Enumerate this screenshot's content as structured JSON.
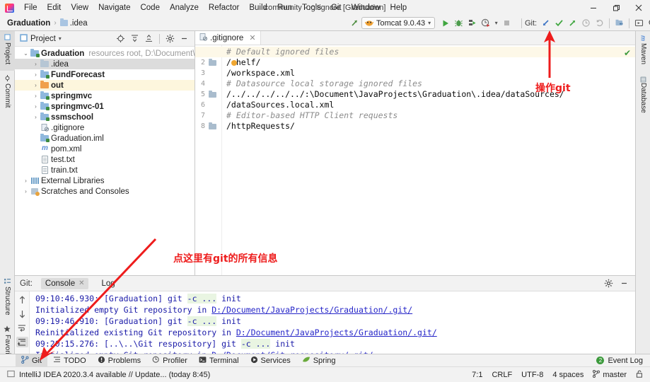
{
  "window": {
    "title": "community - .gitignore [Graduation]",
    "minimize": "—",
    "maximize": "❐",
    "close": "✕"
  },
  "menubar": {
    "logo_name": "intellij-idea-logo",
    "items": [
      "File",
      "Edit",
      "View",
      "Navigate",
      "Code",
      "Analyze",
      "Refactor",
      "Build",
      "Run",
      "Tools",
      "Git",
      "Window",
      "Help"
    ]
  },
  "navbar": {
    "breadcrumbs": [
      "Graduation",
      ".idea"
    ],
    "separator": "›",
    "back_icon": "↖",
    "run_config": {
      "label": "Tomcat 9.0.43",
      "chevron": "▾"
    },
    "run_button": "▶",
    "debug_button": "debug-bug-icon",
    "run_coverage_button": "run-with-coverage-icon",
    "profile_button": "profiler-icon",
    "profile_chevron": "▾",
    "stop_button": "■",
    "git_label": "Git:",
    "git_update": "↙",
    "git_commit": "✓",
    "git_push": "↗",
    "git_history": "◴",
    "git_rollback": "↺",
    "search_everywhere": "⌕",
    "project_structure": "project-structure-icon",
    "select_in": "select-opened-file-icon"
  },
  "left_strip": {
    "top": [
      {
        "label": "Project",
        "icon": "project-icon",
        "selected": true
      },
      {
        "label": "Commit",
        "icon": "commit-icon",
        "selected": false
      }
    ],
    "bottom": [
      {
        "label": "Structure",
        "icon": "structure-icon"
      },
      {
        "label": "Favorites",
        "icon": "star-icon"
      }
    ]
  },
  "right_strip": {
    "items": [
      {
        "label": "Maven",
        "icon": "maven-icon"
      },
      {
        "label": "Database",
        "icon": "database-icon"
      }
    ]
  },
  "project_panel": {
    "title": "Project",
    "title_chevron": "▾",
    "tools": {
      "locate": "crosshair-icon",
      "expand_all": "expand-all-icon",
      "collapse_all": "collapse-all-icon",
      "settings": "gear-icon",
      "hide": "—"
    },
    "tree": [
      {
        "depth": 0,
        "arrow": "⌄",
        "icon": "folder-module",
        "label": "Graduation",
        "bold": true,
        "sub": "resources root, D:\\Document\\JavaProj",
        "state": "none"
      },
      {
        "depth": 1,
        "arrow": "›",
        "icon": "folder-plain",
        "label": ".idea",
        "bold": false,
        "sub": "",
        "state": "selected-grey"
      },
      {
        "depth": 1,
        "arrow": "›",
        "icon": "folder-module",
        "label": "FundForecast",
        "bold": true,
        "sub": "",
        "state": "none"
      },
      {
        "depth": 1,
        "arrow": "›",
        "icon": "folder-excluded",
        "label": "out",
        "bold": true,
        "sub": "",
        "state": "selected-yellow"
      },
      {
        "depth": 1,
        "arrow": "›",
        "icon": "folder-module",
        "label": "springmvc",
        "bold": true,
        "sub": "",
        "state": "none"
      },
      {
        "depth": 1,
        "arrow": "›",
        "icon": "folder-module",
        "label": "springmvc-01",
        "bold": true,
        "sub": "",
        "state": "none"
      },
      {
        "depth": 1,
        "arrow": "›",
        "icon": "folder-module",
        "label": "ssmschool",
        "bold": true,
        "sub": "",
        "state": "none"
      },
      {
        "depth": 1,
        "arrow": "",
        "icon": "gitignore-file",
        "label": ".gitignore",
        "bold": false,
        "sub": "",
        "state": "none"
      },
      {
        "depth": 1,
        "arrow": "",
        "icon": "iml-file",
        "label": "Graduation.iml",
        "bold": false,
        "sub": "",
        "state": "none"
      },
      {
        "depth": 1,
        "arrow": "",
        "icon": "maven-pom",
        "label": "pom.xml",
        "bold": false,
        "sub": "",
        "state": "none"
      },
      {
        "depth": 1,
        "arrow": "",
        "icon": "text-file",
        "label": "test.txt",
        "bold": false,
        "sub": "",
        "state": "none"
      },
      {
        "depth": 1,
        "arrow": "",
        "icon": "text-file",
        "label": "train.txt",
        "bold": false,
        "sub": "",
        "state": "none"
      },
      {
        "depth": 0,
        "arrow": "›",
        "icon": "library-icon",
        "label": "External Libraries",
        "bold": false,
        "sub": "",
        "state": "none"
      },
      {
        "depth": 0,
        "arrow": "›",
        "icon": "scratches-icon",
        "label": "Scratches and Consoles",
        "bold": false,
        "sub": "",
        "state": "none"
      }
    ]
  },
  "editor": {
    "tab": {
      "label": ".gitignore",
      "icon": "gitignore-file-icon",
      "close": "✕"
    },
    "inspection_status": "✔",
    "lines": [
      {
        "n": "1",
        "text": "# Default ignored files",
        "comment": true,
        "fold": false,
        "highlight": true
      },
      {
        "n": "2",
        "text": "/shelf/",
        "comment": false,
        "fold": true,
        "highlight": false
      },
      {
        "n": "3",
        "text": "/workspace.xml",
        "comment": false,
        "fold": false,
        "highlight": false
      },
      {
        "n": "4",
        "text": "# Datasource local storage ignored files",
        "comment": true,
        "fold": false,
        "highlight": false
      },
      {
        "n": "5",
        "text": "/../../../../../:\\Document\\JavaProjects\\Graduation\\.idea/dataSources/",
        "comment": false,
        "fold": true,
        "highlight": false
      },
      {
        "n": "6",
        "text": "/dataSources.local.xml",
        "comment": false,
        "fold": false,
        "highlight": false
      },
      {
        "n": "7",
        "text": "# Editor-based HTTP Client requests",
        "comment": true,
        "fold": false,
        "highlight": false
      },
      {
        "n": "8",
        "text": "/httpRequests/",
        "comment": false,
        "fold": true,
        "highlight": false
      }
    ]
  },
  "git_panel": {
    "label": "Git:",
    "tabs": [
      {
        "label": "Console",
        "selected": true,
        "close": "✕"
      },
      {
        "label": "Log",
        "selected": false,
        "close": ""
      }
    ],
    "tools": {
      "up": "↑",
      "down": "↓",
      "soft_wrap": "soft-wrap-icon",
      "scroll_end": "scroll-to-end-icon",
      "expand": "»",
      "settings": "gear-icon",
      "hide": "—"
    },
    "console_lines": [
      {
        "time": "09:10:46.930: ",
        "pre": "[Graduation] git ",
        "flag": "-c ...",
        "post": " init",
        "link": ""
      },
      {
        "time": "",
        "pre": "Initialized empty Git repository in ",
        "flag": "",
        "post": "",
        "link": "D:/Document/JavaProjects/Graduation/.git/"
      },
      {
        "time": "09:19:46.910: ",
        "pre": "[Graduation] git ",
        "flag": "-c ...",
        "post": " init",
        "link": ""
      },
      {
        "time": "",
        "pre": "Reinitialized existing Git repository in ",
        "flag": "",
        "post": "",
        "link": "D:/Document/JavaProjects/Graduation/.git/"
      },
      {
        "time": "09:20:15.276: ",
        "pre": "[..\\..\\Git respository] git ",
        "flag": "-c ...",
        "post": " init",
        "link": ""
      },
      {
        "time": "",
        "pre": "Initialized empty Git repository in ",
        "flag": "",
        "post": "",
        "link": "D:/Document/Git respository/.git/"
      }
    ]
  },
  "bottom_bar": {
    "items": [
      {
        "label": "Git",
        "icon": "git-branch-icon",
        "selected": true
      },
      {
        "label": "TODO",
        "icon": "todo-list-icon",
        "selected": false
      },
      {
        "label": "Problems",
        "icon": "problems-icon",
        "selected": false
      },
      {
        "label": "Profiler",
        "icon": "profiler-icon",
        "selected": false
      },
      {
        "label": "Terminal",
        "icon": "terminal-icon",
        "selected": false
      },
      {
        "label": "Services",
        "icon": "services-icon",
        "selected": false
      },
      {
        "label": "Spring",
        "icon": "spring-leaf-icon",
        "selected": false
      }
    ],
    "event_log": {
      "label": "Event Log",
      "count": "2"
    }
  },
  "status_bar": {
    "message": "IntelliJ IDEA 2020.3.4 available // Update... (today 8:45)",
    "message_icon": "notification-icon",
    "caret": "7:1",
    "line_separator": "CRLF",
    "encoding": "UTF-8",
    "indent": "4 spaces",
    "branch": "master",
    "branch_icon": "git-branch-icon",
    "lock_icon": "read-write-lock-icon"
  },
  "annotations": [
    {
      "text": "操作git",
      "name": "annotation-operate-git"
    },
    {
      "text": "点这里有git的所有信息",
      "name": "annotation-click-here-git-info"
    }
  ],
  "colors": {
    "accent_red": "#ee1c1c",
    "git_green": "#3c9a3c",
    "link_blue": "#2525c8",
    "highlight_yellow": "#fdf8e8",
    "selection_grey": "#dcdcdc"
  }
}
